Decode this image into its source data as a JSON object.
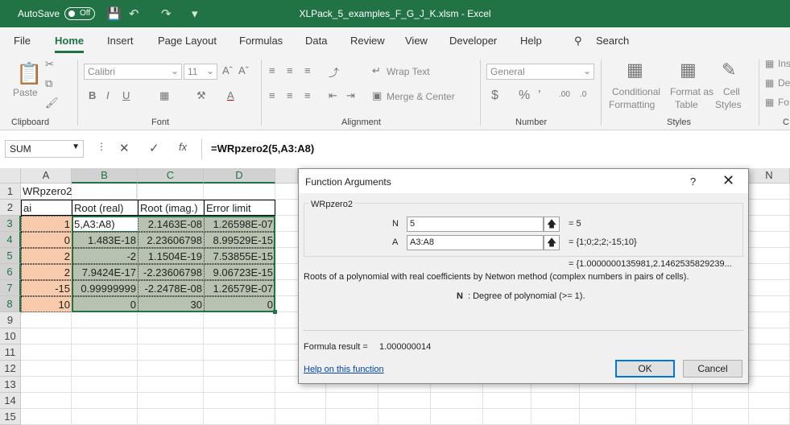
{
  "titlebar": {
    "autosave_label": "AutoSave",
    "autosave_state": "Off",
    "doc_title": "XLPack_5_examples_F_G_J_K.xlsm  -  Excel"
  },
  "menu": {
    "items": [
      "File",
      "Home",
      "Insert",
      "Page Layout",
      "Formulas",
      "Data",
      "Review",
      "View",
      "Developer",
      "Help"
    ],
    "active": "Home",
    "search_label": "Search"
  },
  "ribbon": {
    "clipboard": {
      "paste_label": "Paste",
      "group_label": "Clipboard"
    },
    "font": {
      "name": "Calibri",
      "size": "11",
      "group_label": "Font"
    },
    "alignment": {
      "wrap_text": "Wrap Text",
      "merge_center": "Merge & Center",
      "group_label": "Alignment"
    },
    "number": {
      "format": "General",
      "group_label": "Number"
    },
    "styles": {
      "conditional_1": "Conditional",
      "conditional_2": "Formatting",
      "format_as_1": "Format as",
      "format_as_2": "Table",
      "cell_1": "Cell",
      "cell_2": "Styles",
      "group_label": "Styles"
    },
    "cells": {
      "insert": "Ins",
      "delete": "De",
      "format": "Fo",
      "group_label": "C"
    }
  },
  "formula_bar": {
    "name_box": "SUM",
    "formula": "=WRpzero2(5,A3:A8)"
  },
  "sheet": {
    "columns": [
      "A",
      "B",
      "C",
      "D",
      "N"
    ],
    "rows": [
      "1",
      "2",
      "3",
      "4",
      "5",
      "6",
      "7",
      "8",
      "9",
      "10",
      "11",
      "12",
      "13",
      "14",
      "15"
    ],
    "a1": "WRpzero2",
    "headers": [
      "ai",
      "Root (real)",
      "Root (imag.)",
      "Error limit"
    ],
    "data": [
      [
        "1",
        "5,A3:A8)",
        "2.1463E-08",
        "1.26598E-07"
      ],
      [
        "0",
        "1.483E-18",
        "2.23606798",
        "8.99529E-15"
      ],
      [
        "2",
        "-2",
        "1.1504E-19",
        "7.53855E-15"
      ],
      [
        "2",
        "7.9424E-17",
        "-2.23606798",
        "9.06723E-15"
      ],
      [
        "-15",
        "0.99999999",
        "-2.2478E-08",
        "1.26579E-07"
      ],
      [
        "10",
        "0",
        "30",
        "0"
      ]
    ]
  },
  "dialog": {
    "title": "Function Arguments",
    "help_glyph": "?",
    "close_glyph": "✕",
    "function_name": "WRpzero2",
    "args": [
      {
        "label": "N",
        "value": "5",
        "result": "=  5"
      },
      {
        "label": "A",
        "value": "A3:A8",
        "result": "=  {1;0;2;2;-15;10}"
      }
    ],
    "overall_result": "=  {1.0000000135981,2.1462535829239...",
    "description": "Roots of a polynomial with real coefficients by Netwon method (complex numbers in pairs of cells).",
    "arg_help_name": "N",
    "arg_help_text": ":  Degree of polynomial (>= 1).",
    "formula_result_label": "Formula result =",
    "formula_result_value": "1.000000014",
    "help_link": "Help on this function",
    "ok_label": "OK",
    "cancel_label": "Cancel"
  },
  "colors": {
    "excel_green": "#217346",
    "ai_fill": "#f8cbad",
    "result_fill": "#b7c2b0"
  }
}
